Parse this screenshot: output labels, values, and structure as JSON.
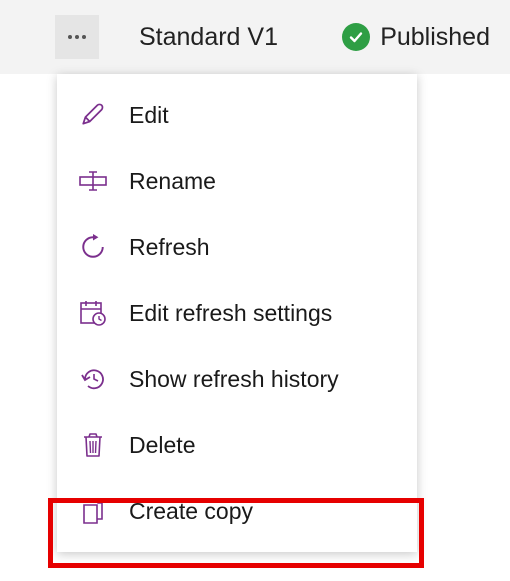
{
  "header": {
    "title": "Standard V1",
    "status_label": "Published"
  },
  "menu": {
    "items": [
      {
        "id": "edit",
        "icon": "pencil-icon",
        "label": "Edit"
      },
      {
        "id": "rename",
        "icon": "rename-icon",
        "label": "Rename"
      },
      {
        "id": "refresh",
        "icon": "refresh-icon",
        "label": "Refresh"
      },
      {
        "id": "edit-refresh-settings",
        "icon": "calendar-clock-icon",
        "label": "Edit refresh settings"
      },
      {
        "id": "show-refresh-history",
        "icon": "history-icon",
        "label": "Show refresh history"
      },
      {
        "id": "delete",
        "icon": "trash-icon",
        "label": "Delete"
      },
      {
        "id": "create-copy",
        "icon": "copy-icon",
        "label": "Create copy",
        "highlighted": true
      }
    ]
  },
  "colors": {
    "icon_accent": "#7b2f8d",
    "status_green": "#2e9e44",
    "highlight_red": "#e60000"
  }
}
